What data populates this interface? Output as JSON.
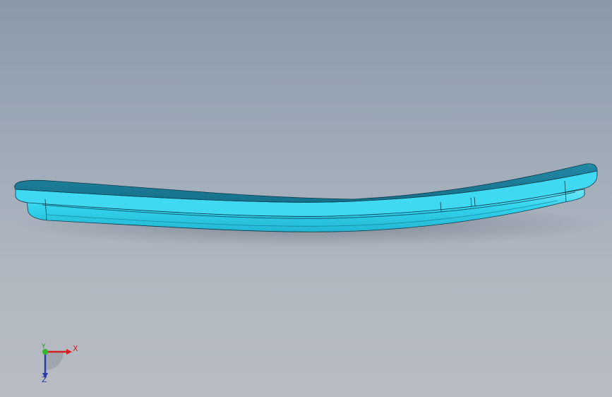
{
  "viewport": {
    "background_top": "#8a99aa",
    "background_bottom": "#b7bcc2"
  },
  "model": {
    "shape": "curved-bar",
    "color_top": "#1b7e9a",
    "color_side": "#34d4ee",
    "color_highlight": "#6ee8fb",
    "edge_color": "#0c3a4a"
  },
  "triad": {
    "x_label": "X",
    "y_label": "Y",
    "z_label": "Z",
    "x_color": "#d42020",
    "y_color": "#1f9a1f",
    "z_color": "#2a3aa8"
  }
}
